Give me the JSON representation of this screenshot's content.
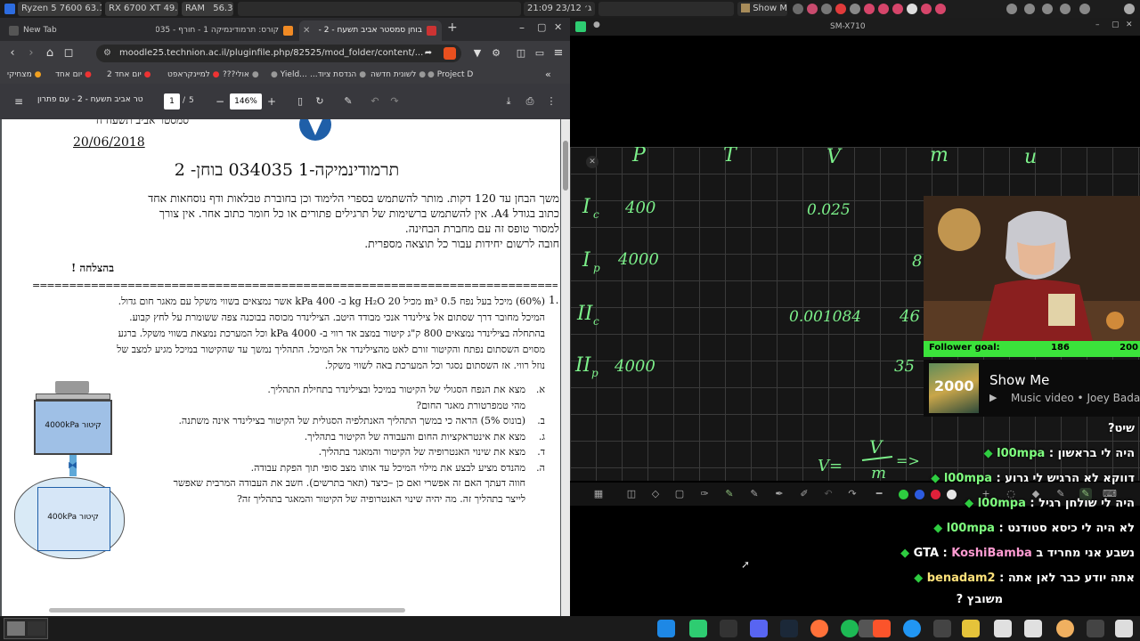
{
  "system_panel": {
    "cpu": "Ryzen 5 7600  63.1 °C",
    "gpu": "RX 6700 XT 49.0 °C",
    "ram_label": "RAM",
    "ram_value": "56.3%",
    "datetime": "21:09 יום ג׳ 23/12",
    "media_label": "Show Me"
  },
  "browser": {
    "tabs": [
      {
        "label": "New Tab"
      },
      {
        "label": "קורס: תרמודינמיקה 1 - חורף - 035"
      },
      {
        "label": "בוחן סמסטר אביב תשעח - 2 -"
      }
    ],
    "new_tab": "+",
    "url": "moodle25.technion.ac.il/pluginfile.php/82525/mod_folder/content/...",
    "bookmarks": [
      "מצחיקי",
      "יום אחד",
      "יום אחד 2",
      "למיינקראפט",
      "אולי???",
      "Yield...",
      "הנדסת ציוד...",
      "לשונית חדשה",
      "Project D"
    ],
    "pdf_toolbar": {
      "title": "טר אביב תשעח - 2 - עם פתרון",
      "page_current": "1",
      "page_sep": "/",
      "page_total": "5",
      "zoom": "146%"
    }
  },
  "document": {
    "header_partial": "סמסטר  אביב תשעח  ח",
    "date": "20/06/2018",
    "title": "תרמודינמיקה-1 034035 בוחן- 2",
    "instructions": [
      "משך הבחן עד 120 דקות. מותר להשתמש בספרי הלימוד וכן בחוברת טבלאות ודף נוסחאות אחד",
      "כתוב בגודל A4.  אין להשתמש ברשימות של תרגילים פתורים או כל חומר כתוב אחר. אין צורך",
      "למסור טופס זה עם מחברת הבחינה.",
      "חובה לרשום יחידות עבור כל תוצאה מספרית."
    ],
    "good_luck": "בהצלחה !",
    "separator": "================================================================================",
    "q_number": "1.",
    "q_points": "(60%)",
    "q_lines": [
      "מיכל בעל נפח 0.5 m³ מכיל  20 kg  H₂O ב- 400 kPa אשר נמצאים בשווי משקל עם מאגר חום גדול.",
      "המיכל מחובר דרך שסתום אל צילינדר אנכי מבודד היטב. הצילינדר מכוסה בבוכנה צפה ששומרת על לחץ קבוע.",
      "בהתחלה בצילינדר נמצאים 800 ק\"ג קיטור במצב אד רווי ב- 4000 kPa וכל המערכת נמצאת בשווי משקל. ברגע",
      "מסוים השסתום נפתח והקיטור זורם לאט מהצילינדר אל המיכל. התהליך נמשך עד שהקיטור במיכל מגיע למצב של",
      "נוזל רווי. אז השסתום נסגר וכל המערכת באה לשווי משקל."
    ],
    "subquestions": [
      {
        "label": "א.",
        "text": "מצא את הנפח הסגולי של הקיטור במיכל ובצילינדר בתחילת התהליך."
      },
      {
        "label": "",
        "text": "מהי טמפרטורת מאגר החום?"
      },
      {
        "label": "ב.",
        "text": "(בונוס 5%) הראה כי במשך התהליך האנתלפיה הסגולית של הקיטור בצילינדר אינה משתנה."
      },
      {
        "label": "ג.",
        "text": "מצא את אינטראקציות החום והעבודה של הקיטור בתהליך."
      },
      {
        "label": "ד.",
        "text": "מצא את שינוי האנטרופיה של הקיטור והמאגר בתהליך."
      },
      {
        "label": "ה.",
        "text": "מהנדס מציע לבצע את מילוי המיכל עד אותו מצב סופי תוך הפקת עבודה."
      },
      {
        "label": "",
        "text": "חווה דעתך האם זה אפשרי ואם כן –כיצד (תאר בתרשים). חשב את העבודה המרבית שאפשר"
      },
      {
        "label": "",
        "text": "לייצר בתהליך זה. מה יהיה שינוי האנטרופיה של הקיטור והמאגר בתהליך זה?"
      }
    ],
    "figure": {
      "upper_label": "קיטור 4000kPa",
      "lower_label": "קיטור 400kPa"
    }
  },
  "drawing_app": {
    "window_title": "SM-X710",
    "handwriting": {
      "headers": [
        "P",
        "T",
        "V",
        "m",
        "u"
      ],
      "rows": [
        {
          "label": "I",
          "sub": "c",
          "P": "400",
          "v": "0.025",
          "extra": ""
        },
        {
          "label": "I",
          "sub": "p",
          "P": "4000",
          "v": "",
          "extra": "8"
        },
        {
          "label": "II",
          "sub": "c",
          "P": "",
          "v": "0.001084",
          "extra": "46"
        },
        {
          "label": "II",
          "sub": "p",
          "P": "4000",
          "v": "",
          "extra": "35"
        }
      ],
      "formula_left": "V=",
      "formula_num": "V",
      "formula_den": "m",
      "formula_arrow": "=>"
    }
  },
  "stream_overlay": {
    "follower_goal_label": "Follower goal:",
    "follower_goal_current": "186",
    "follower_goal_target": "200",
    "now_playing_title": "Show Me",
    "now_playing_sub": "Music video • Joey Bada",
    "album_text": "2000",
    "chat": [
      {
        "user": "",
        "text": "שיט?"
      },
      {
        "user": "l00mpa",
        "text": "היה לי בראשון"
      },
      {
        "user": "l00mpa",
        "text": "דווקא לא הרגיש לי גרוע"
      },
      {
        "user": "l00mpa",
        "text": "היה לי שולחן רגיל"
      },
      {
        "user": "l00mpa",
        "text": "לא היה לי כיסא סטודנט"
      },
      {
        "user": "KoshiBamba",
        "text": "נשבע אני מחריד ב GTA"
      },
      {
        "user": "benadam2",
        "text": "אתה יודע כבר לאן אתה"
      },
      {
        "user": "",
        "text": "משובץ ?"
      }
    ]
  },
  "colors": {
    "ink": "#7cf08a",
    "goal_bar": "#3be33b",
    "user_green": "#7fff7f",
    "user_pink": "#ff9bd2",
    "user_yellow": "#ffe27a"
  }
}
